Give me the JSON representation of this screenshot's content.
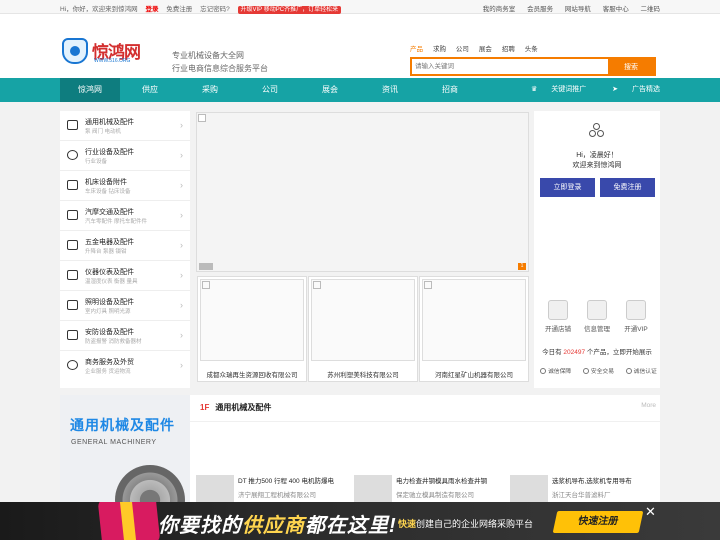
{
  "topbar": {
    "greeting": "Hi，你好，欢迎来到惊鸿网",
    "login": "登录",
    "register": "免费注册",
    "forgot": "忘记密码?",
    "promo": "升级VIP 移动PC齐推广，订单轻松来",
    "links": [
      "我的商务室",
      "会员服务",
      "网站导航",
      "客服中心",
      "二维码"
    ]
  },
  "header": {
    "logo_name": "惊鸿网",
    "logo_url": "WWW.516.ORG",
    "slogan1": "专业机械设备大全网",
    "slogan2": "行业电商信息综合服务平台"
  },
  "search": {
    "tabs": [
      "产品",
      "求购",
      "公司",
      "展会",
      "招聘",
      "头条"
    ],
    "active_tab": "产品",
    "placeholder": "请输入关键词",
    "button": "搜索"
  },
  "nav": {
    "items": [
      "惊鸿网",
      "供应",
      "采购",
      "公司",
      "展会",
      "资讯",
      "招商"
    ],
    "right": [
      "关键词推广",
      "广告精选"
    ]
  },
  "categories": [
    {
      "title": "通用机械及配件",
      "sub": "泵  阀门  电动机"
    },
    {
      "title": "行业设备及配件",
      "sub": "行业设备"
    },
    {
      "title": "机床设备附件",
      "sub": "车床设备  钻床设备"
    },
    {
      "title": "汽摩交通及配件",
      "sub": "汽车零配件  摩托车配件件"
    },
    {
      "title": "五金电器及配件",
      "sub": "升降台  泵器  镊钳"
    },
    {
      "title": "仪器仪表及配件",
      "sub": "温湿度仪表  衡器  量具"
    },
    {
      "title": "照明设备及配件",
      "sub": "室内灯具  照明光源"
    },
    {
      "title": "安防设备及配件",
      "sub": "防盗报警  消防救备器材"
    },
    {
      "title": "商务服务及外贸",
      "sub": "企业服务  货运物流"
    }
  ],
  "banner": {
    "page_indicator": "1"
  },
  "thumbs": [
    {
      "caption": "成都众瑞再生资源回收有限公司"
    },
    {
      "caption": "苏州利塑美科技有限公司"
    },
    {
      "caption": "河南红星矿山机器有限公司"
    }
  ],
  "user_panel": {
    "hi": "Hi，凌晨好！",
    "welcome": "欢迎来到惊鸿网",
    "login_button": "立即登录",
    "register_button": "免费注册",
    "quick_links": [
      "开通店铺",
      "信息管理",
      "开通VIP"
    ],
    "count_prefix": "今日有",
    "count_value": "202497",
    "count_suffix": "个产品，立即开始展示",
    "trust": [
      "诚信保障",
      "安全交易",
      "诚信认证"
    ]
  },
  "floor": {
    "number": "1F",
    "title": "通用机械及配件",
    "more": "More",
    "banner_cn": "通用机械及配件",
    "banner_en": "GENERAL MACHINERY",
    "products": [
      {
        "title": "DT 推力500 行程 400 电机防爆电",
        "company": "济宁展翔工程机械有限公司"
      },
      {
        "title": "电力检查井钢模具雨水检查井钢",
        "company": "保定驰立模具制造有限公司"
      },
      {
        "title": "选浆机导布,选浆机专用导布",
        "company": "浙江天台华普滤料厂"
      }
    ]
  },
  "ad": {
    "text1": "你要找的",
    "text2": "供应商",
    "text3": "都在这里!",
    "small_em": "快速",
    "small": "创建自己的企业网络采购平台",
    "cta": "快速注册",
    "close": "✕"
  }
}
